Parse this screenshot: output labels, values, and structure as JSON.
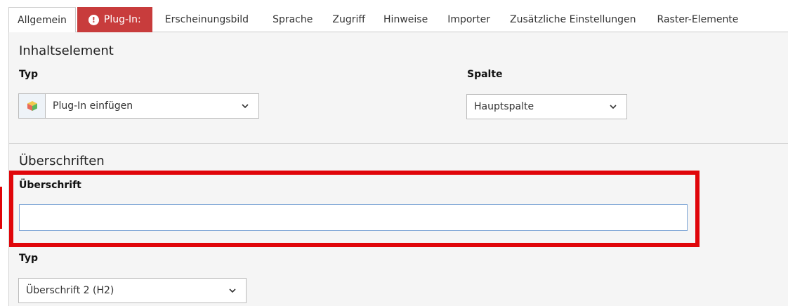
{
  "tabs": [
    {
      "label": "Allgemein",
      "state": "active"
    },
    {
      "label": "Plug-In:",
      "state": "error"
    },
    {
      "label": "Erscheinungsbild"
    },
    {
      "label": "Sprache"
    },
    {
      "label": "Zugriff"
    },
    {
      "label": "Hinweise"
    },
    {
      "label": "Importer"
    },
    {
      "label": "Zusätzliche Einstellungen"
    },
    {
      "label": "Raster-Elemente"
    }
  ],
  "error_icon_glyph": "!",
  "content_element": {
    "title": "Inhaltselement",
    "type_label": "Typ",
    "type_value": "Plug-In einfügen",
    "column_label": "Spalte",
    "column_value": "Hauptspalte"
  },
  "headers": {
    "title": "Überschriften",
    "header_label": "Überschrift",
    "header_value": "",
    "header_type_label": "Typ",
    "header_type_value": "Überschrift 2 (H2)"
  },
  "colors": {
    "error_tab": "#c83c3c",
    "highlight": "#e0060a",
    "input_border": "#7fa6d6"
  }
}
